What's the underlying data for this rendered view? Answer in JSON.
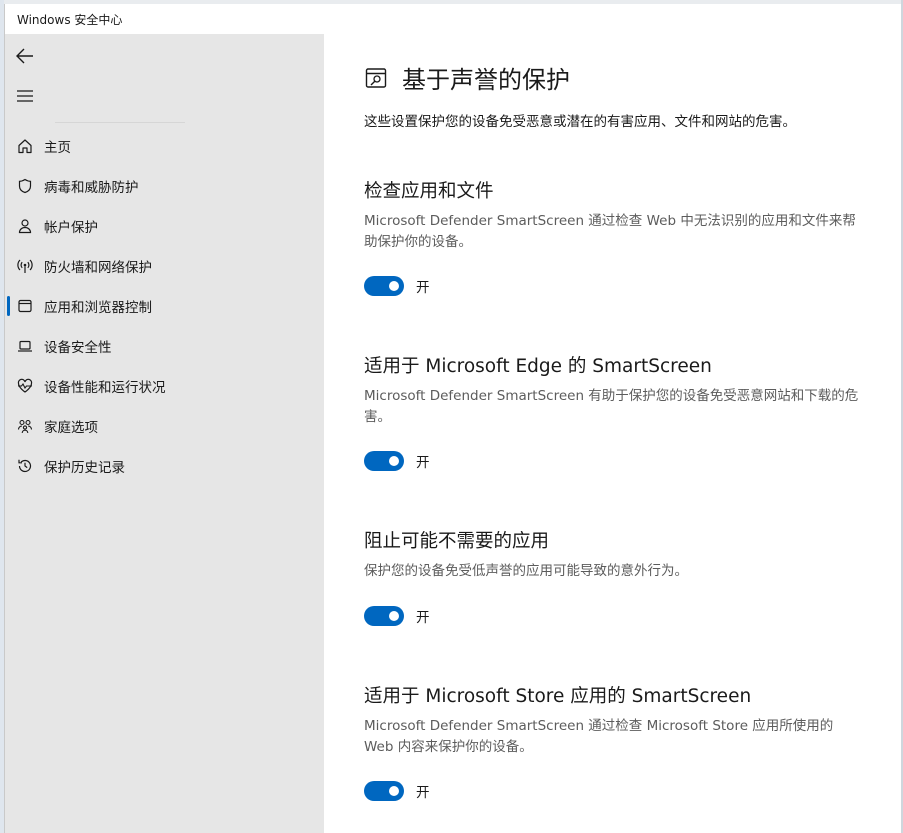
{
  "window": {
    "title": "Windows 安全中心"
  },
  "sidebar": {
    "items": [
      {
        "label": "主页",
        "icon": "home-icon"
      },
      {
        "label": "病毒和威胁防护",
        "icon": "shield-icon"
      },
      {
        "label": "帐户保护",
        "icon": "person-icon"
      },
      {
        "label": "防火墙和网络保护",
        "icon": "antenna-icon"
      },
      {
        "label": "应用和浏览器控制",
        "icon": "app-window-icon",
        "active": true
      },
      {
        "label": "设备安全性",
        "icon": "laptop-icon"
      },
      {
        "label": "设备性能和运行状况",
        "icon": "heart-pulse-icon"
      },
      {
        "label": "家庭选项",
        "icon": "family-icon"
      },
      {
        "label": "保护历史记录",
        "icon": "history-icon"
      }
    ]
  },
  "main": {
    "title": "基于声誉的保护",
    "description": "这些设置保护您的设备免受恶意或潜在的有害应用、文件和网站的危害。",
    "sections": [
      {
        "title": "检查应用和文件",
        "description": "Microsoft Defender SmartScreen 通过检查 Web 中无法识别的应用和文件来帮助保护你的设备。",
        "toggle_label": "开",
        "toggle_on": true
      },
      {
        "title": "适用于 Microsoft Edge 的 SmartScreen",
        "description": "Microsoft Defender SmartScreen 有助于保护您的设备免受恶意网站和下载的危害。",
        "toggle_label": "开",
        "toggle_on": true
      },
      {
        "title": "阻止可能不需要的应用",
        "description": "保护您的设备免受低声誉的应用可能导致的意外行为。",
        "toggle_label": "开",
        "toggle_on": true
      },
      {
        "title": "适用于 Microsoft Store 应用的 SmartScreen",
        "description": "Microsoft Defender SmartScreen 通过检查 Microsoft Store 应用所使用的 Web 内容来保护你的设备。",
        "toggle_label": "开",
        "toggle_on": true
      }
    ]
  },
  "colors": {
    "accent": "#0067c0",
    "sidebar_bg": "#e6e6e6"
  }
}
